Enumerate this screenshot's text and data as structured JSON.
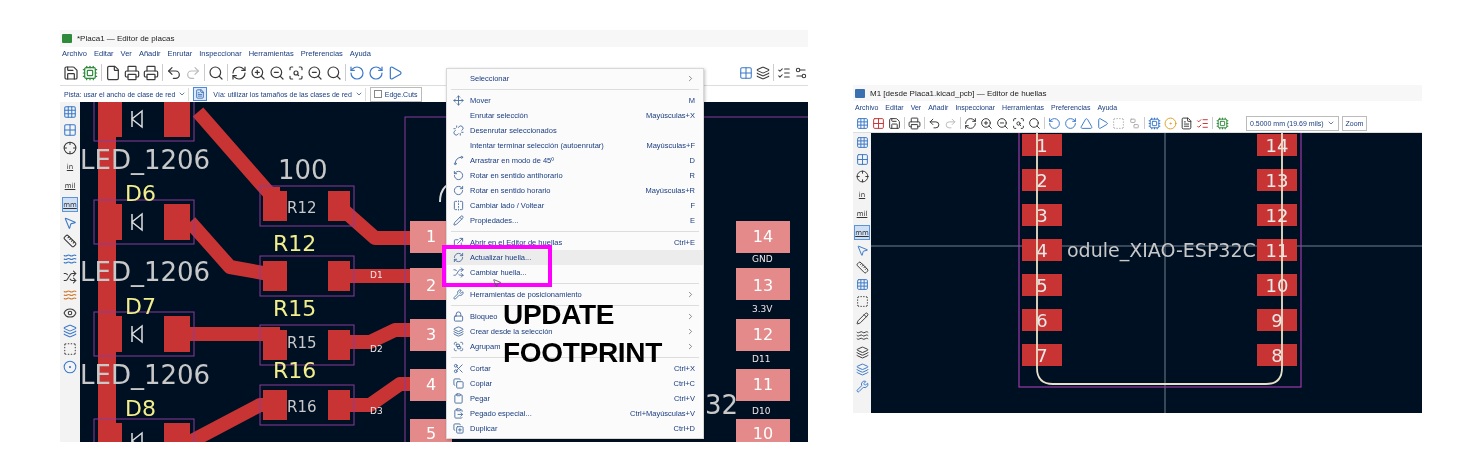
{
  "board_editor": {
    "title": "*Placa1 — Editor de placas",
    "menu": [
      "Archivo",
      "Editar",
      "Ver",
      "Añadir",
      "Enrutar",
      "Inspeccionar",
      "Herramientas",
      "Preferencias",
      "Ayuda"
    ],
    "track_width": "Pista: usar el ancho de clase de red",
    "via_size": "Vía: utilizar los tamaños de las clases de red",
    "layer": "Edge.Cuts",
    "units": [
      {
        "label": "in",
        "selected": false
      },
      {
        "label": "mil",
        "selected": false
      },
      {
        "label": "mm",
        "selected": true
      }
    ],
    "canvas_labels": [
      {
        "text": "LED_1206",
        "kind": "fab"
      },
      {
        "text": "100",
        "kind": "fab"
      },
      {
        "text": "D6",
        "kind": "ref"
      },
      {
        "text": "R12",
        "kind": "body"
      },
      {
        "text": "1",
        "kind": "pad"
      },
      {
        "text": "14",
        "kind": "pad"
      },
      {
        "text": "R12",
        "kind": "ref"
      },
      {
        "text": "GND",
        "kind": "net"
      },
      {
        "text": "D1",
        "kind": "net"
      },
      {
        "text": "LED_1206",
        "kind": "fab"
      },
      {
        "text": "2",
        "kind": "pad"
      },
      {
        "text": "13",
        "kind": "pad"
      },
      {
        "text": "D7",
        "kind": "ref"
      },
      {
        "text": "R15",
        "kind": "ref"
      },
      {
        "text": "3.3V",
        "kind": "net"
      },
      {
        "text": "3",
        "kind": "pad"
      },
      {
        "text": "12",
        "kind": "pad"
      },
      {
        "text": "R15",
        "kind": "body"
      },
      {
        "text": "D2",
        "kind": "net"
      },
      {
        "text": "D11",
        "kind": "net"
      },
      {
        "text": "LED_1206",
        "kind": "fab"
      },
      {
        "text": "R16",
        "kind": "ref"
      },
      {
        "text": "4",
        "kind": "pad"
      },
      {
        "text": "11",
        "kind": "pad"
      },
      {
        "text": "D8",
        "kind": "ref"
      },
      {
        "text": "R16",
        "kind": "body"
      },
      {
        "text": "D3",
        "kind": "net"
      },
      {
        "text": "32",
        "kind": "fab"
      },
      {
        "text": "D10",
        "kind": "net"
      },
      {
        "text": "5",
        "kind": "pad"
      },
      {
        "text": "10",
        "kind": "pad"
      }
    ],
    "context_menu": [
      {
        "kind": "item",
        "label": "Seleccionar",
        "submenu": true,
        "selected": false
      },
      {
        "kind": "separator"
      },
      {
        "kind": "item",
        "label": "Mover",
        "shortcut": "M",
        "submenu": false,
        "selected": false
      },
      {
        "kind": "item",
        "label": "Enrutar selección",
        "shortcut": "Mayúsculas+X",
        "submenu": false,
        "selected": false
      },
      {
        "kind": "item",
        "label": "Desenrutar seleccionados",
        "submenu": false,
        "selected": false
      },
      {
        "kind": "item",
        "label": "Intentar terminar selección (autoenrutar)",
        "shortcut": "Mayúsculas+F",
        "submenu": false,
        "selected": false
      },
      {
        "kind": "item",
        "label": "Arrastrar en modo de 45º",
        "shortcut": "D",
        "submenu": false,
        "selected": false
      },
      {
        "kind": "item",
        "label": "Rotar en sentido antihorario",
        "shortcut": "R",
        "submenu": false,
        "selected": false
      },
      {
        "kind": "item",
        "label": "Rotar en sentido horario",
        "shortcut": "Mayúsculas+R",
        "submenu": false,
        "selected": false
      },
      {
        "kind": "item",
        "label": "Cambiar lado / Voltear",
        "shortcut": "F",
        "submenu": false,
        "selected": false
      },
      {
        "kind": "item",
        "label": "Propiedades...",
        "shortcut": "E",
        "submenu": false,
        "selected": false
      },
      {
        "kind": "separator"
      },
      {
        "kind": "item",
        "label": "Abrir en el Editor de huellas",
        "shortcut": "Ctrl+E",
        "submenu": false,
        "selected": false
      },
      {
        "kind": "item",
        "label": "Actualizar huella...",
        "submenu": false,
        "selected": true
      },
      {
        "kind": "item",
        "label": "Cambiar huella...",
        "submenu": false,
        "selected": false
      },
      {
        "kind": "separator"
      },
      {
        "kind": "item",
        "label": "Herramientas de posicionamiento",
        "submenu": true,
        "selected": false
      },
      {
        "kind": "separator"
      },
      {
        "kind": "item",
        "label": "Bloqueo",
        "submenu": true,
        "selected": false
      },
      {
        "kind": "item",
        "label": "Crear desde la selección",
        "submenu": true,
        "selected": false
      },
      {
        "kind": "item",
        "label": "Agrupam",
        "submenu": true,
        "selected": false
      },
      {
        "kind": "separator"
      },
      {
        "kind": "item",
        "label": "Cortar",
        "shortcut": "Ctrl+X",
        "submenu": false,
        "selected": false
      },
      {
        "kind": "item",
        "label": "Copiar",
        "shortcut": "Ctrl+C",
        "submenu": false,
        "selected": false
      },
      {
        "kind": "item",
        "label": "Pegar",
        "shortcut": "Ctrl+V",
        "submenu": false,
        "selected": false
      },
      {
        "kind": "item",
        "label": "Pegado especial...",
        "shortcut": "Ctrl+Mayúsculas+V",
        "submenu": false,
        "selected": false
      },
      {
        "kind": "item",
        "label": "Duplicar",
        "shortcut": "Ctrl+D",
        "submenu": false,
        "selected": false
      }
    ],
    "caption": [
      "UPDATE",
      "FOOTPRINT"
    ]
  },
  "footprint_editor": {
    "title": "M1 [desde Placa1.kicad_pcb] — Editor de huellas",
    "menu": [
      "Archivo",
      "Editar",
      "Ver",
      "Añadir",
      "Inspeccionar",
      "Herramientas",
      "Preferencias",
      "Ayuda"
    ],
    "grid": "0.5000 mm (19.69 mils)",
    "zoom": "Zoom",
    "units": [
      {
        "label": "in",
        "selected": false
      },
      {
        "label": "mil",
        "selected": false
      },
      {
        "label": "mm",
        "selected": true
      }
    ],
    "left_pads": [
      "1",
      "2",
      "3",
      "4",
      "5",
      "6",
      "7"
    ],
    "right_pads": [
      "14",
      "13",
      "12",
      "11",
      "10",
      "9",
      "8"
    ],
    "footprint_label": "odule_XIAO-ESP32C"
  }
}
